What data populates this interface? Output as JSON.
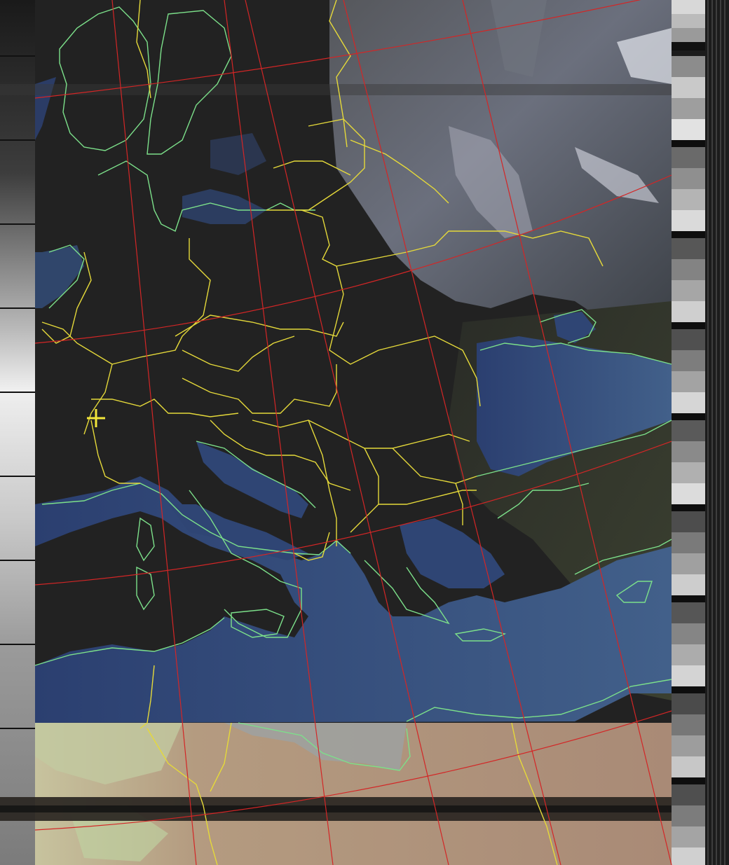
{
  "image": {
    "kind": "satellite-weather-image",
    "palette": {
      "sea": "#2f4574",
      "land_dark": "#222222",
      "clouds": "#8c8f9b",
      "desert": "#b69a7e",
      "desert_light": "#c9c2a6",
      "coast_line": "#7ce08a",
      "border_line": "#e5d93a",
      "graticule_line": "#d32626",
      "marker": "#f2e63a",
      "telemetry_dark": "#111111",
      "telemetry_light": "#d7d7d7"
    }
  },
  "marker": {
    "icon": "crosshair-marker-icon"
  }
}
